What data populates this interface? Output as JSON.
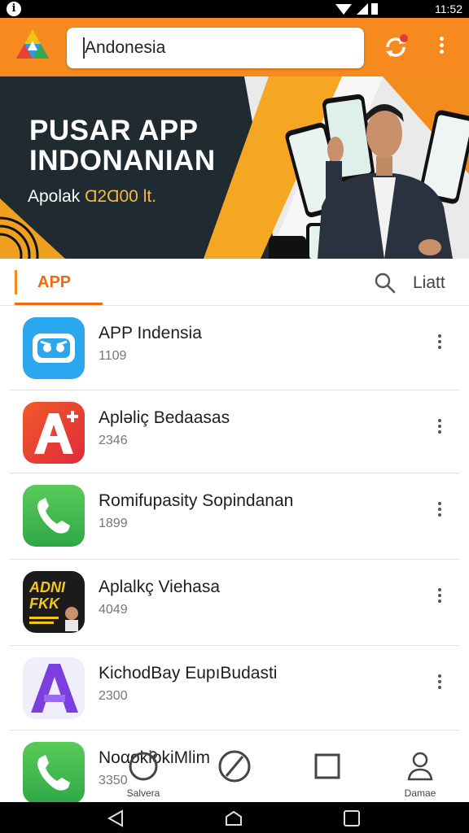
{
  "status_bar": {
    "time": "11:52"
  },
  "appbar": {
    "search_value": "Andonesia",
    "logo_icon": "triangle-logo-icon",
    "sync_icon": "sync-icon",
    "menu_icon": "more-vert-icon",
    "accent": "#f68a1e"
  },
  "banner": {
    "title_line1": "PUSAR APP",
    "title_line2": "INDONANIAN",
    "subtitle_prefix": "Apolak",
    "subtitle_highlight": "Ɑ2Ɑ00 lt."
  },
  "tabs": {
    "active_label": "APP",
    "right_label": "Liatt"
  },
  "apps": [
    {
      "name": "APP Indensia",
      "count": "1109",
      "icon": "chat-bot-icon",
      "color": "#2aa7ee"
    },
    {
      "name": "Aplәliç Bedaasas",
      "count": "2346",
      "icon": "letter-a-plus-icon",
      "color": "#e8402a"
    },
    {
      "name": "Romifupasity Sopindanan",
      "count": "1899",
      "icon": "phone-icon",
      "color": "#3bb54a"
    },
    {
      "name": "Aplalkç Viehasa",
      "count": "4049",
      "icon": "adni-game-icon",
      "color": "#1b1b1b",
      "icon_text_1": "ADNI",
      "icon_text_2": "FKK"
    },
    {
      "name": "KichodBay EupıBudasti",
      "count": "2300",
      "icon": "letter-a-purple-icon",
      "color": "#7b3fe0"
    },
    {
      "name": "NoαokiokiMlim",
      "count": "3350",
      "icon": "phone-icon",
      "color": "#3bb54a"
    }
  ],
  "bottom_nav": [
    {
      "label": "Salvera",
      "icon": "circle-icon"
    },
    {
      "label": "",
      "icon": "slash-circle-icon"
    },
    {
      "label": "",
      "icon": "square-icon"
    },
    {
      "label": "Damae",
      "icon": "person-icon"
    }
  ],
  "system_nav": {
    "back": "back-triangle-icon",
    "home": "home-circle-icon",
    "recents": "recents-square-icon"
  }
}
